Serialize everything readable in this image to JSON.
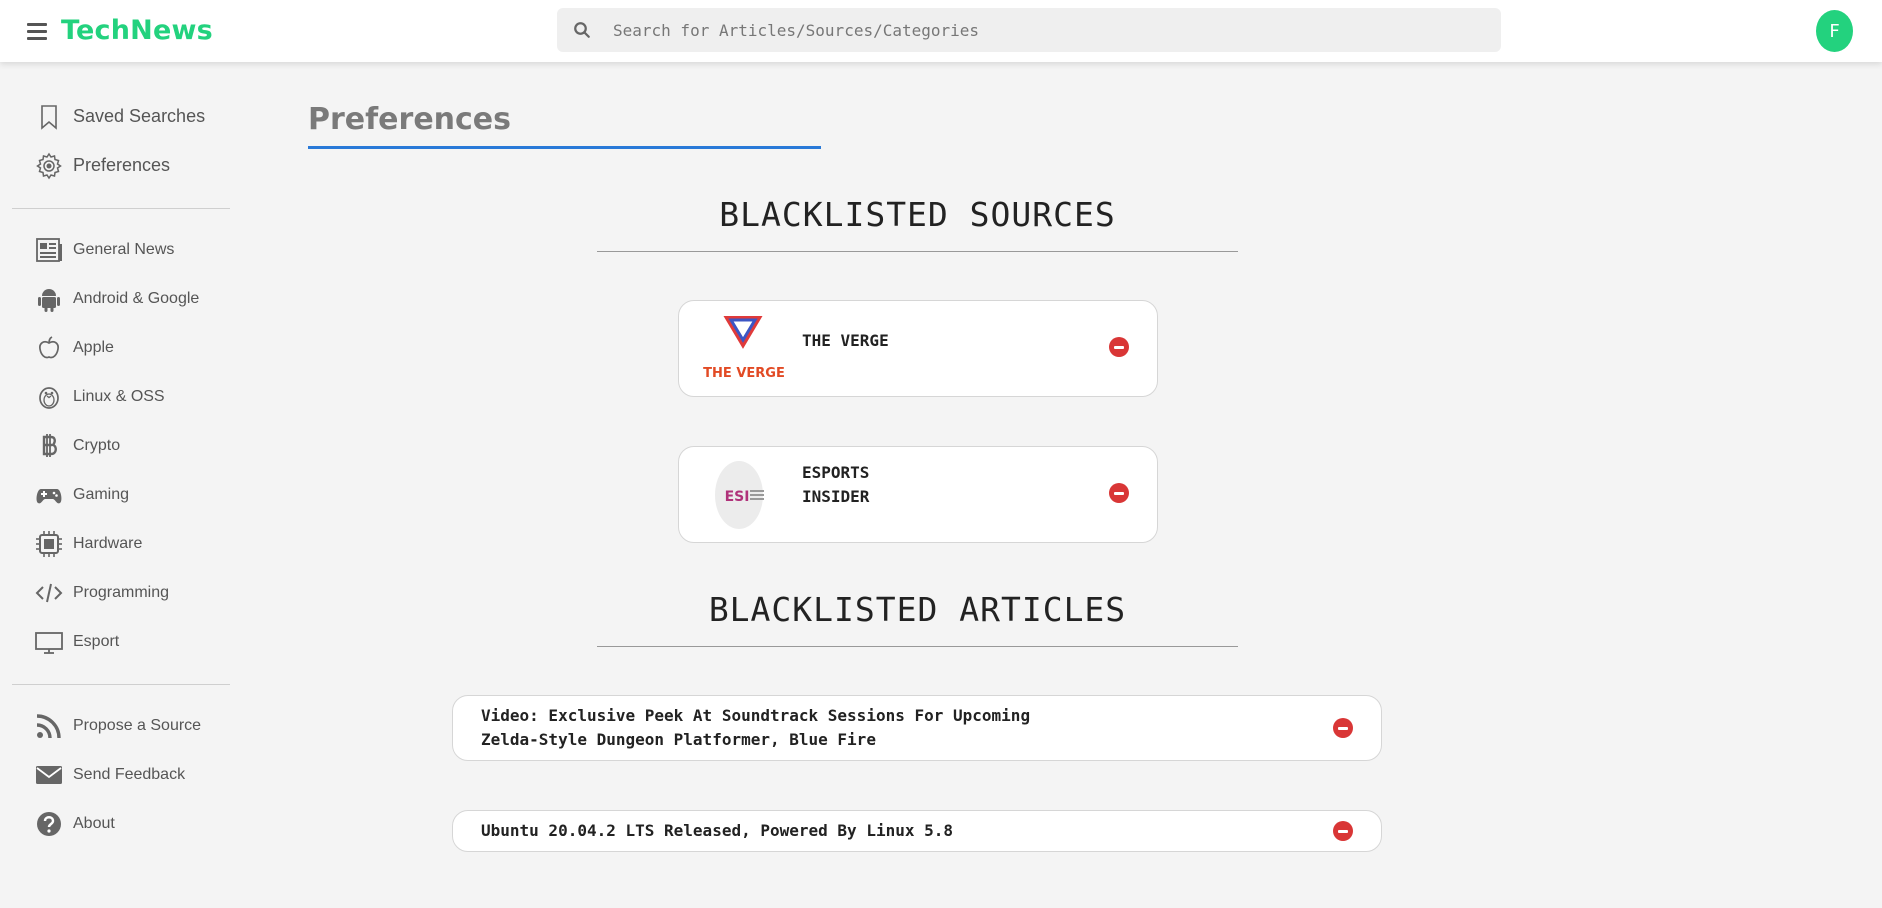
{
  "header": {
    "brand": "TechNews",
    "search_placeholder": "Search for Articles/Sources/Categories",
    "avatar_initial": "F"
  },
  "sidebar": {
    "top_items": [
      {
        "label": "Saved Searches",
        "icon": "bookmark-icon"
      },
      {
        "label": "Preferences",
        "icon": "gear-icon"
      }
    ],
    "categories": [
      {
        "label": "General News",
        "icon": "newspaper-icon"
      },
      {
        "label": "Android & Google",
        "icon": "android-icon"
      },
      {
        "label": "Apple",
        "icon": "apple-icon"
      },
      {
        "label": "Linux & OSS",
        "icon": "penguin-icon"
      },
      {
        "label": "Crypto",
        "icon": "bitcoin-icon"
      },
      {
        "label": "Gaming",
        "icon": "gamepad-icon"
      },
      {
        "label": "Hardware",
        "icon": "chip-icon"
      },
      {
        "label": "Programming",
        "icon": "code-icon"
      },
      {
        "label": "Esport",
        "icon": "monitor-icon"
      }
    ],
    "bottom_items": [
      {
        "label": "Propose a Source",
        "icon": "rss-icon"
      },
      {
        "label": "Send Feedback",
        "icon": "envelope-icon"
      },
      {
        "label": "About",
        "icon": "question-icon"
      }
    ]
  },
  "main": {
    "title": "Preferences",
    "blacklisted_sources_title": "BLACKLISTED SOURCES",
    "sources": [
      {
        "name": "THE VERGE",
        "logo_text": "THE VERGE"
      },
      {
        "name_line1": "ESPORTS",
        "name_line2": "INSIDER",
        "logo_text": "ESI"
      }
    ],
    "blacklisted_articles_title": "BLACKLISTED ARTICLES",
    "articles": [
      {
        "line1": "Video: Exclusive Peek At Soundtrack Sessions For Upcoming",
        "line2": "Zelda-Style Dungeon Platformer, Blue Fire"
      },
      {
        "line1": "Ubuntu 20.04.2 LTS Released, Powered By Linux 5.8"
      }
    ]
  },
  "colors": {
    "brand": "#23d27e",
    "accent": "#2979d8",
    "remove": "#d93636"
  }
}
